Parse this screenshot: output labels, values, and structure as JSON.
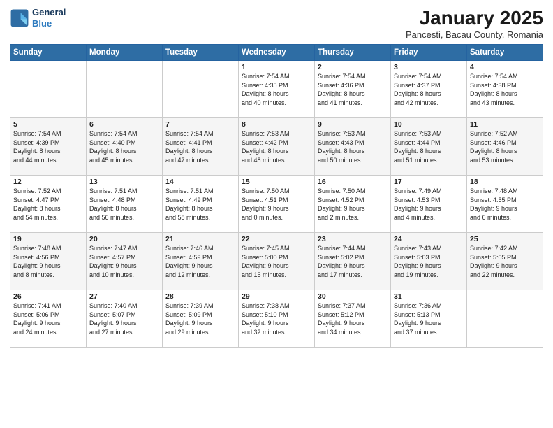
{
  "logo": {
    "line1": "General",
    "line2": "Blue"
  },
  "title": "January 2025",
  "subtitle": "Pancesti, Bacau County, Romania",
  "days_header": [
    "Sunday",
    "Monday",
    "Tuesday",
    "Wednesday",
    "Thursday",
    "Friday",
    "Saturday"
  ],
  "weeks": [
    [
      {
        "num": "",
        "info": ""
      },
      {
        "num": "",
        "info": ""
      },
      {
        "num": "",
        "info": ""
      },
      {
        "num": "1",
        "info": "Sunrise: 7:54 AM\nSunset: 4:35 PM\nDaylight: 8 hours\nand 40 minutes."
      },
      {
        "num": "2",
        "info": "Sunrise: 7:54 AM\nSunset: 4:36 PM\nDaylight: 8 hours\nand 41 minutes."
      },
      {
        "num": "3",
        "info": "Sunrise: 7:54 AM\nSunset: 4:37 PM\nDaylight: 8 hours\nand 42 minutes."
      },
      {
        "num": "4",
        "info": "Sunrise: 7:54 AM\nSunset: 4:38 PM\nDaylight: 8 hours\nand 43 minutes."
      }
    ],
    [
      {
        "num": "5",
        "info": "Sunrise: 7:54 AM\nSunset: 4:39 PM\nDaylight: 8 hours\nand 44 minutes."
      },
      {
        "num": "6",
        "info": "Sunrise: 7:54 AM\nSunset: 4:40 PM\nDaylight: 8 hours\nand 45 minutes."
      },
      {
        "num": "7",
        "info": "Sunrise: 7:54 AM\nSunset: 4:41 PM\nDaylight: 8 hours\nand 47 minutes."
      },
      {
        "num": "8",
        "info": "Sunrise: 7:53 AM\nSunset: 4:42 PM\nDaylight: 8 hours\nand 48 minutes."
      },
      {
        "num": "9",
        "info": "Sunrise: 7:53 AM\nSunset: 4:43 PM\nDaylight: 8 hours\nand 50 minutes."
      },
      {
        "num": "10",
        "info": "Sunrise: 7:53 AM\nSunset: 4:44 PM\nDaylight: 8 hours\nand 51 minutes."
      },
      {
        "num": "11",
        "info": "Sunrise: 7:52 AM\nSunset: 4:46 PM\nDaylight: 8 hours\nand 53 minutes."
      }
    ],
    [
      {
        "num": "12",
        "info": "Sunrise: 7:52 AM\nSunset: 4:47 PM\nDaylight: 8 hours\nand 54 minutes."
      },
      {
        "num": "13",
        "info": "Sunrise: 7:51 AM\nSunset: 4:48 PM\nDaylight: 8 hours\nand 56 minutes."
      },
      {
        "num": "14",
        "info": "Sunrise: 7:51 AM\nSunset: 4:49 PM\nDaylight: 8 hours\nand 58 minutes."
      },
      {
        "num": "15",
        "info": "Sunrise: 7:50 AM\nSunset: 4:51 PM\nDaylight: 9 hours\nand 0 minutes."
      },
      {
        "num": "16",
        "info": "Sunrise: 7:50 AM\nSunset: 4:52 PM\nDaylight: 9 hours\nand 2 minutes."
      },
      {
        "num": "17",
        "info": "Sunrise: 7:49 AM\nSunset: 4:53 PM\nDaylight: 9 hours\nand 4 minutes."
      },
      {
        "num": "18",
        "info": "Sunrise: 7:48 AM\nSunset: 4:55 PM\nDaylight: 9 hours\nand 6 minutes."
      }
    ],
    [
      {
        "num": "19",
        "info": "Sunrise: 7:48 AM\nSunset: 4:56 PM\nDaylight: 9 hours\nand 8 minutes."
      },
      {
        "num": "20",
        "info": "Sunrise: 7:47 AM\nSunset: 4:57 PM\nDaylight: 9 hours\nand 10 minutes."
      },
      {
        "num": "21",
        "info": "Sunrise: 7:46 AM\nSunset: 4:59 PM\nDaylight: 9 hours\nand 12 minutes."
      },
      {
        "num": "22",
        "info": "Sunrise: 7:45 AM\nSunset: 5:00 PM\nDaylight: 9 hours\nand 15 minutes."
      },
      {
        "num": "23",
        "info": "Sunrise: 7:44 AM\nSunset: 5:02 PM\nDaylight: 9 hours\nand 17 minutes."
      },
      {
        "num": "24",
        "info": "Sunrise: 7:43 AM\nSunset: 5:03 PM\nDaylight: 9 hours\nand 19 minutes."
      },
      {
        "num": "25",
        "info": "Sunrise: 7:42 AM\nSunset: 5:05 PM\nDaylight: 9 hours\nand 22 minutes."
      }
    ],
    [
      {
        "num": "26",
        "info": "Sunrise: 7:41 AM\nSunset: 5:06 PM\nDaylight: 9 hours\nand 24 minutes."
      },
      {
        "num": "27",
        "info": "Sunrise: 7:40 AM\nSunset: 5:07 PM\nDaylight: 9 hours\nand 27 minutes."
      },
      {
        "num": "28",
        "info": "Sunrise: 7:39 AM\nSunset: 5:09 PM\nDaylight: 9 hours\nand 29 minutes."
      },
      {
        "num": "29",
        "info": "Sunrise: 7:38 AM\nSunset: 5:10 PM\nDaylight: 9 hours\nand 32 minutes."
      },
      {
        "num": "30",
        "info": "Sunrise: 7:37 AM\nSunset: 5:12 PM\nDaylight: 9 hours\nand 34 minutes."
      },
      {
        "num": "31",
        "info": "Sunrise: 7:36 AM\nSunset: 5:13 PM\nDaylight: 9 hours\nand 37 minutes."
      },
      {
        "num": "",
        "info": ""
      }
    ]
  ]
}
